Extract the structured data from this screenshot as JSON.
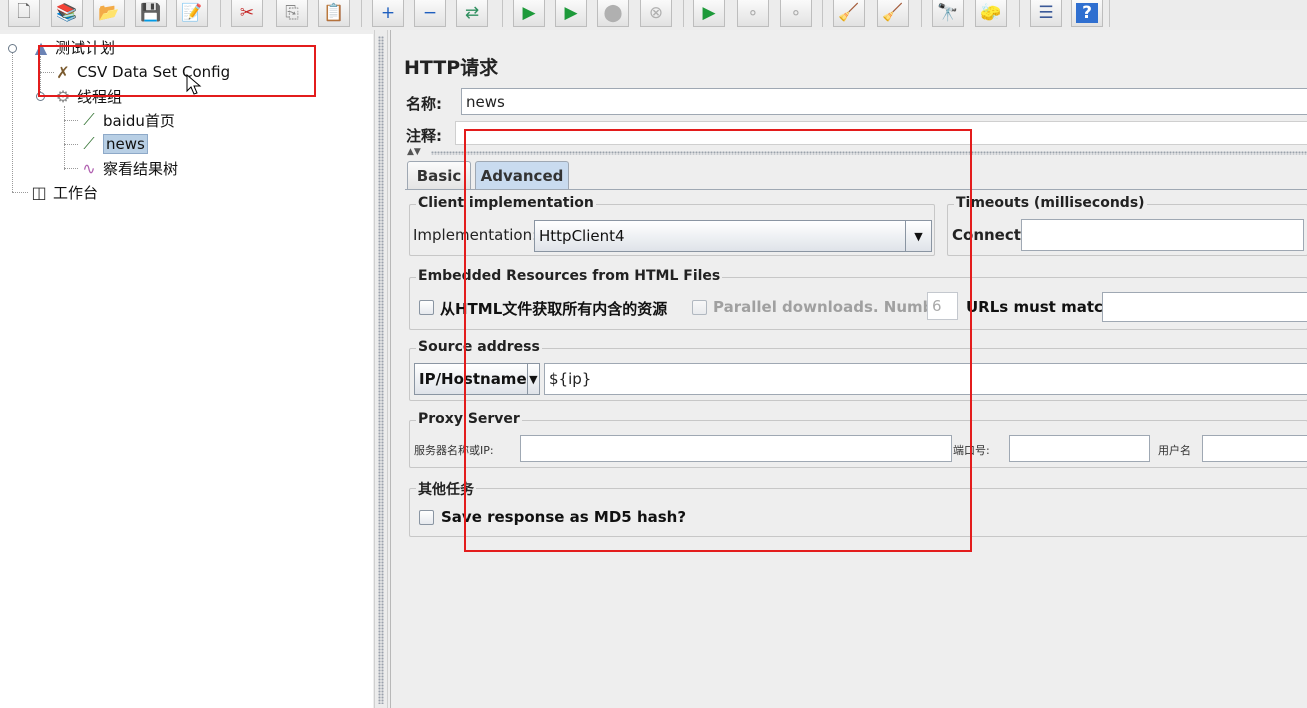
{
  "toolbar": {
    "buttons": [
      {
        "name": "new-icon",
        "glyph": "🗋"
      },
      {
        "name": "templates-icon",
        "glyph": "📚"
      },
      {
        "name": "open-icon",
        "glyph": "📂"
      },
      {
        "name": "save-icon",
        "glyph": "💾"
      },
      {
        "name": "save-as-icon",
        "glyph": "📝"
      },
      {
        "name": "cut-icon",
        "glyph": "✂"
      },
      {
        "name": "copy-icon",
        "glyph": "⎘"
      },
      {
        "name": "paste-icon",
        "glyph": "📋"
      },
      {
        "name": "expand-icon",
        "glyph": "+"
      },
      {
        "name": "collapse-icon",
        "glyph": "−"
      },
      {
        "name": "toggle-icon",
        "glyph": "⇄"
      },
      {
        "name": "start-icon",
        "glyph": "▶"
      },
      {
        "name": "start-no-pause-icon",
        "glyph": "▶"
      },
      {
        "name": "stop-icon",
        "glyph": "⬤"
      },
      {
        "name": "shutdown-icon",
        "glyph": "⊗"
      },
      {
        "name": "remote-start-icon",
        "glyph": "▶"
      },
      {
        "name": "remote-stop-icon",
        "glyph": "∘"
      },
      {
        "name": "remote-shutdown-icon",
        "glyph": "∘"
      },
      {
        "name": "clear-icon",
        "glyph": "🧹"
      },
      {
        "name": "clear-all-icon",
        "glyph": "🧹"
      },
      {
        "name": "search-icon",
        "glyph": "🔭"
      },
      {
        "name": "reset-search-icon",
        "glyph": "🧽"
      },
      {
        "name": "function-helper-icon",
        "glyph": "☰"
      },
      {
        "name": "help-icon",
        "glyph": "?"
      }
    ]
  },
  "tree": {
    "root": "测试计划",
    "csv": "CSV Data Set Config",
    "thread_group": "线程组",
    "sampler1": "baidu首页",
    "sampler2": "news",
    "listener": "察看结果树",
    "workbench": "工作台"
  },
  "panel": {
    "title": "HTTP请求",
    "name_label": "名称:",
    "name_value": "news",
    "comment_label": "注释:",
    "comment_value": ""
  },
  "tabs": {
    "basic": "Basic",
    "advanced": "Advanced"
  },
  "client_impl": {
    "title": "Client implementation",
    "impl_label": "Implementation:",
    "impl_value": "HttpClient4"
  },
  "timeouts": {
    "title": "Timeouts (milliseconds)",
    "connect_label": "Connect:",
    "connect_value": ""
  },
  "embedded": {
    "title": "Embedded Resources from HTML Files",
    "retrieve_label": "从HTML文件获取所有内含的资源",
    "parallel_label": "Parallel downloads. Number:",
    "parallel_value": "6",
    "urls_label": "URLs must match:",
    "urls_value": ""
  },
  "source": {
    "title": "Source address",
    "type_value": "IP/Hostname",
    "address_value": "${ip}"
  },
  "proxy": {
    "title": "Proxy Server",
    "server_label": "服务器名称或IP:",
    "server_value": "",
    "port_label": "端口号:",
    "port_value": "",
    "user_label": "用户名",
    "user_value": ""
  },
  "other": {
    "title": "其他任务",
    "md5_label": "Save response as MD5 hash?"
  },
  "colors": {
    "annotation_red": "#e31c1c",
    "selection": "#b8cfe5",
    "active_tab": "#c9dbef"
  }
}
